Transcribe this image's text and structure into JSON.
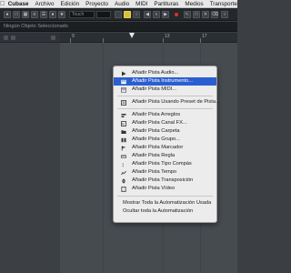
{
  "menubar": {
    "items": [
      "Cubase",
      "Archivo",
      "Edición",
      "Proyecto",
      "Audio",
      "MIDI",
      "Partituras",
      "Medios",
      "Transporte"
    ]
  },
  "toolbar": {
    "touch_field": "Touch"
  },
  "infoline": {
    "text": "Ningún Objeto Seleccionado"
  },
  "ruler": {
    "labels": [
      "9",
      "13",
      "17"
    ]
  },
  "context_menu": {
    "items": [
      {
        "label": "Añadir Pista Audio...",
        "icon": "audio-track-icon"
      },
      {
        "label": "Añadir Pista Instrumento...",
        "icon": "instrument-track-icon",
        "highlighted": true
      },
      {
        "label": "Añadir Pista MIDI...",
        "icon": "midi-track-icon"
      },
      {
        "label": "Añadir Pista Usando Preset de Pista...",
        "icon": "track-preset-icon"
      },
      {
        "label": "Añadir Pista Arreglos",
        "icon": "arranger-track-icon"
      },
      {
        "label": "Añadir Pista Canal FX...",
        "icon": "fx-channel-icon"
      },
      {
        "label": "Añadir Pista Carpeta",
        "icon": "folder-track-icon"
      },
      {
        "label": "Añadir Pista Grupo...",
        "icon": "group-track-icon"
      },
      {
        "label": "Añadir Pista Marcador",
        "icon": "marker-track-icon"
      },
      {
        "label": "Añadir Pista Regla",
        "icon": "ruler-track-icon"
      },
      {
        "label": "Añadir Pista Tipo Compás",
        "icon": "signature-track-icon"
      },
      {
        "label": "Añadir Pista Tempo",
        "icon": "tempo-track-icon"
      },
      {
        "label": "Añadir Pista Transposición",
        "icon": "transpose-track-icon"
      },
      {
        "label": "Añadir Pista Vídeo",
        "icon": "video-track-icon"
      },
      {
        "label": "Mostrar Toda la Automatización Usada",
        "icon": ""
      },
      {
        "label": "Ocultar toda la Automatización",
        "icon": ""
      }
    ]
  },
  "colors": {
    "highlight": "#2b5fd0",
    "record": "#d9332a"
  }
}
